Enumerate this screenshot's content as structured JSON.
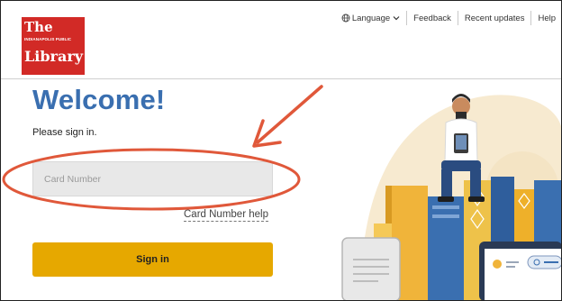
{
  "logo": {
    "line1": "The",
    "line2": "INDIANAPOLIS PUBLIC",
    "line3": "Library"
  },
  "topnav": {
    "language": "Language",
    "feedback": "Feedback",
    "recent_updates": "Recent updates",
    "help": "Help"
  },
  "signin": {
    "title": "Welcome!",
    "prompt": "Please sign in.",
    "card_placeholder": "Card Number",
    "card_help": "Card Number help",
    "button": "Sign in"
  },
  "colors": {
    "brand_red": "#d22a26",
    "title_blue": "#3a6fb0",
    "button_gold": "#e6a800",
    "annotation_orange": "#e0583a"
  },
  "icons": [
    "globe-icon",
    "chevron-down-icon"
  ]
}
